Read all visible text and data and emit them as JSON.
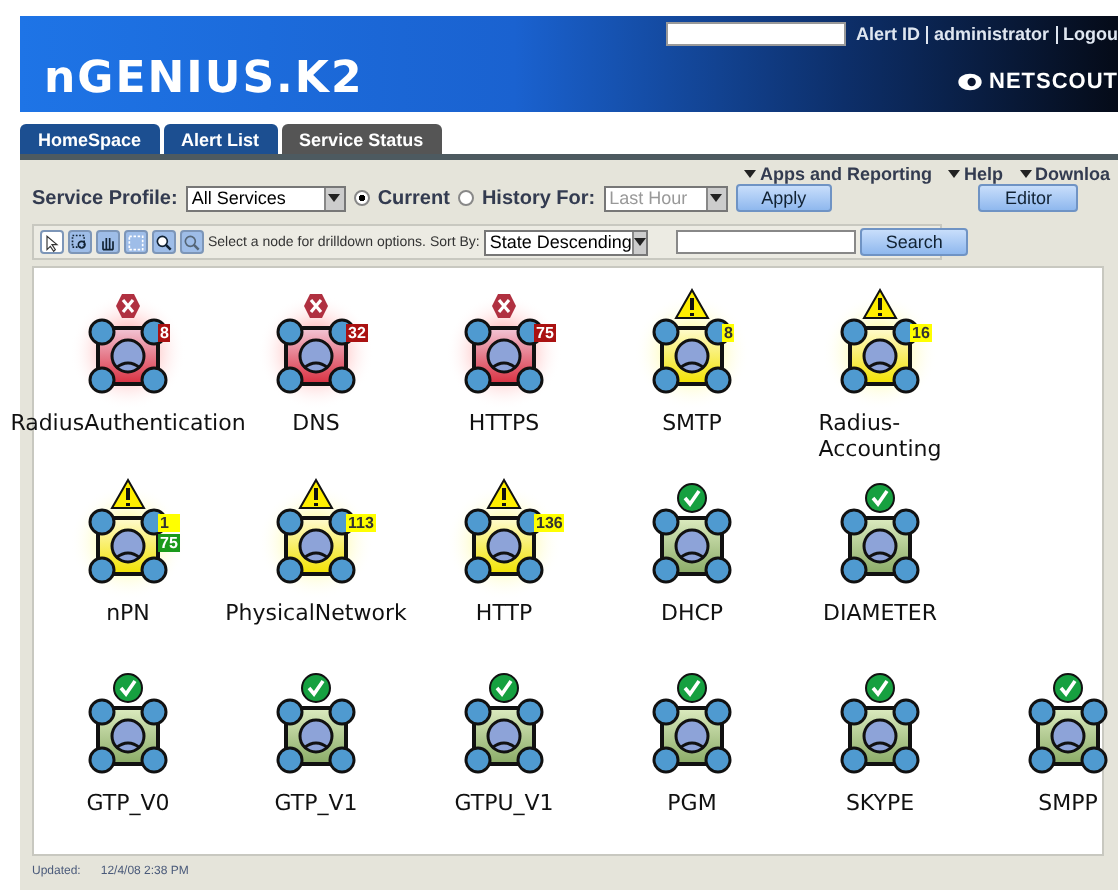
{
  "header": {
    "logo": "nGENIUS.K2",
    "links": [
      "Alert ID",
      "administrator",
      "Logou"
    ],
    "brand": "NETSCOUT"
  },
  "tabs": [
    {
      "label": "HomeSpace",
      "selected": false
    },
    {
      "label": "Alert List",
      "selected": false
    },
    {
      "label": "Service Status",
      "selected": true
    }
  ],
  "top_links": [
    "Apps and Reporting",
    "Help",
    "Downloa"
  ],
  "editor_button": "Editor",
  "filters": {
    "profile_label": "Service Profile:",
    "profile_value": "All Services",
    "modes": [
      {
        "label": "Current",
        "selected": true
      },
      {
        "label": "History For:",
        "selected": false
      }
    ],
    "history_value": "Last Hour",
    "history_disabled": true,
    "apply": "Apply"
  },
  "toolbar": {
    "tools": [
      {
        "kind": "pointer",
        "selected": true
      },
      {
        "kind": "zoom-region",
        "selected": false
      },
      {
        "kind": "pan",
        "selected": false
      },
      {
        "kind": "fit",
        "selected": false
      },
      {
        "kind": "zoom-in",
        "selected": false
      },
      {
        "kind": "zoom-out",
        "selected": false
      }
    ],
    "hint": "Select a node for drilldown options.",
    "sort_label": "Sort By:",
    "sort_value": "State Descending",
    "search_button": "Search"
  },
  "node_rows": [
    [
      {
        "name": "RadiusAuthentication",
        "kind": "critical",
        "counts": [
          {
            "text": "8",
            "kind": "critical"
          }
        ]
      },
      {
        "name": "DNS",
        "kind": "critical",
        "counts": [
          {
            "text": "32",
            "kind": "critical"
          }
        ]
      },
      {
        "name": "HTTPS",
        "kind": "critical",
        "counts": [
          {
            "text": "75",
            "kind": "critical"
          }
        ]
      },
      {
        "name": "SMTP",
        "kind": "warning",
        "counts": [
          {
            "text": "8",
            "kind": "warning"
          }
        ]
      },
      {
        "name": "Radius-\nAccounting",
        "kind": "warning",
        "counts": [
          {
            "text": "16",
            "kind": "warning"
          }
        ]
      }
    ],
    [
      {
        "name": "nPN",
        "kind": "warning",
        "counts": [
          {
            "text": "1",
            "kind": "warning"
          },
          {
            "text": "75",
            "kind": "ok"
          }
        ]
      },
      {
        "name": "PhysicalNetwork",
        "kind": "warning",
        "counts": [
          {
            "text": "113",
            "kind": "warning"
          }
        ]
      },
      {
        "name": "HTTP",
        "kind": "warning",
        "counts": [
          {
            "text": "136",
            "kind": "warning"
          }
        ]
      },
      {
        "name": "DHCP",
        "kind": "ok"
      },
      {
        "name": "DIAMETER",
        "kind": "ok"
      }
    ],
    [
      {
        "name": "GTP_V0",
        "kind": "ok"
      },
      {
        "name": "GTP_V1",
        "kind": "ok"
      },
      {
        "name": "GTPU_V1",
        "kind": "ok"
      },
      {
        "name": "PGM",
        "kind": "ok"
      },
      {
        "name": "SKYPE",
        "kind": "ok"
      },
      {
        "name": "SMPP",
        "kind": "ok"
      }
    ]
  ],
  "footer": {
    "label": "Updated:",
    "time": "12/4/08 2:38 PM"
  }
}
